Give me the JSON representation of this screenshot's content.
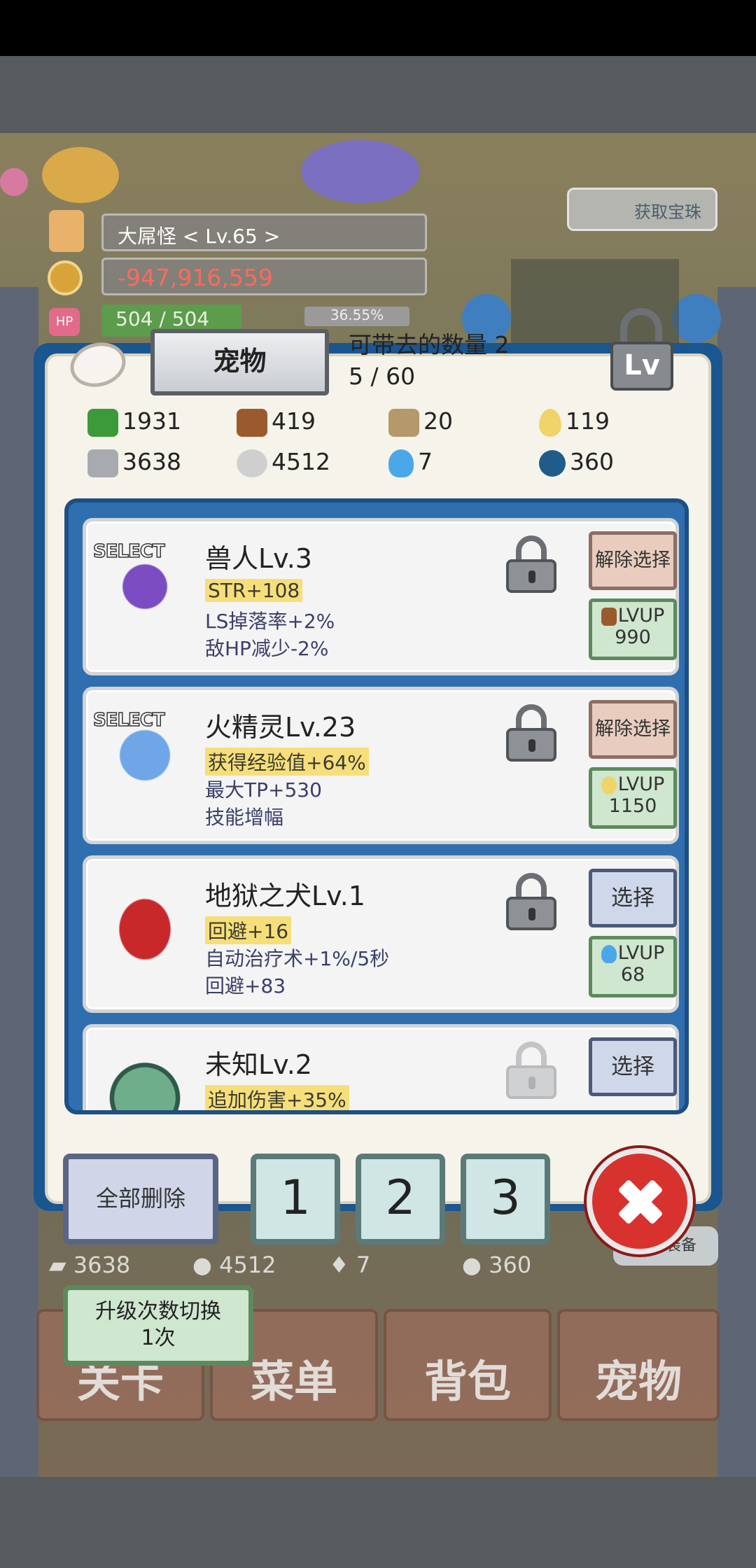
{
  "hud": {
    "name": "大屌怪   < Lv.65 >",
    "gold": "-947,916,559",
    "hp_icon": "HP",
    "hp": "504 / 504",
    "exp": "36.55%",
    "get_button": "获取宝珠"
  },
  "panel": {
    "title": "宠物",
    "carry_text": "可带去的数量 2",
    "count_text": "5 / 60",
    "lock_lv": "Lv"
  },
  "resources": [
    {
      "icon": "herb-icon",
      "value": "1931"
    },
    {
      "icon": "wood-icon",
      "value": "419"
    },
    {
      "icon": "plank-icon",
      "value": "20"
    },
    {
      "icon": "oil-drop-icon",
      "value": "119"
    },
    {
      "icon": "iron-icon",
      "value": "3638"
    },
    {
      "icon": "stone-icon",
      "value": "4512"
    },
    {
      "icon": "blue-flame-icon",
      "value": "7"
    },
    {
      "icon": "blue-orb-icon",
      "value": "360"
    }
  ],
  "pets": [
    {
      "select_tag": "SELECT",
      "name": "兽人Lv.3",
      "s1": "STR+108",
      "s2": "LS掉落率+2%",
      "s3": "敌HP减少-2%",
      "action": "解除选择",
      "lvup_label": "LVUP",
      "lvup_cost": "990",
      "cost_icon": "wood-icon"
    },
    {
      "select_tag": "SELECT",
      "name": "火精灵Lv.23",
      "s1": "获得经验值+64%",
      "s2": "最大TP+530",
      "s3": "技能增幅",
      "action": "解除选择",
      "lvup_label": "LVUP",
      "lvup_cost": "1150",
      "cost_icon": "oil-drop-icon"
    },
    {
      "select_tag": "",
      "name": "地狱之犬Lv.1",
      "s1": "回避+16",
      "s2": "自动治疗术+1%/5秒",
      "s3": "回避+83",
      "action": "选择",
      "lvup_label": "LVUP",
      "lvup_cost": "68",
      "cost_icon": "blue-flame-icon"
    },
    {
      "select_tag": "",
      "name": "未知Lv.2",
      "s1": "追加伤害+35%",
      "s2": "",
      "s3": "",
      "action": "选择",
      "lvup_label": "",
      "lvup_cost": "",
      "cost_icon": ""
    }
  ],
  "bottom": {
    "delete_all": "全部删除",
    "slot1": "1",
    "slot2": "2",
    "slot3": "3",
    "switch_line1": "升级次数切换",
    "switch_line2": "1次"
  },
  "behind": {
    "res_iron": "3638",
    "res_stone": "4512",
    "res_flame": "7",
    "res_orb": "360",
    "equip_button": "全部装备",
    "nav_stage": "关卡",
    "nav_menu": "菜单",
    "nav_bag": "背包",
    "nav_pet": "宠物"
  },
  "colors": {
    "panel_blue": "#1a5690",
    "list_blue": "#2f6fb0",
    "highlight_yellow": "#f6df7a",
    "deselect_bg": "#e8cdbf",
    "select_bg": "#cfd8ea",
    "lvup_bg": "#cfe6cf",
    "close_red": "#d8322e"
  }
}
